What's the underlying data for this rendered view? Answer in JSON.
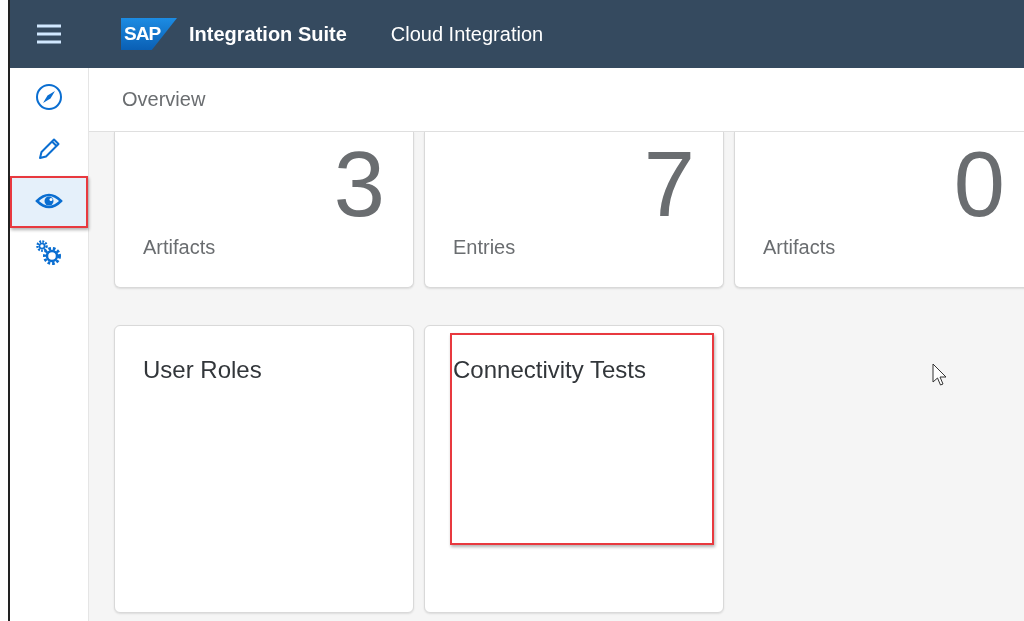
{
  "header": {
    "brand": "SAP",
    "product": "Integration Suite",
    "section": "Cloud Integration"
  },
  "sidebar": {
    "items": [
      {
        "kind": "compass",
        "selected": false,
        "highlighted": false
      },
      {
        "kind": "pencil",
        "selected": false,
        "highlighted": false
      },
      {
        "kind": "eye",
        "selected": true,
        "highlighted": true
      },
      {
        "kind": "gears",
        "selected": false,
        "highlighted": false
      }
    ]
  },
  "page_title": "Overview",
  "tiles": [
    {
      "number": "3",
      "label": "Artifacts",
      "cut": true,
      "highlighted": false
    },
    {
      "number": "7",
      "label": "Entries",
      "cut": true,
      "highlighted": false
    },
    {
      "number": "0",
      "label": "Artifacts",
      "cut": true,
      "highlighted": false
    },
    {
      "title": "User Roles",
      "cut": false,
      "highlighted": false
    },
    {
      "title": "Connectivity Tests",
      "cut": false,
      "highlighted": true
    }
  ]
}
